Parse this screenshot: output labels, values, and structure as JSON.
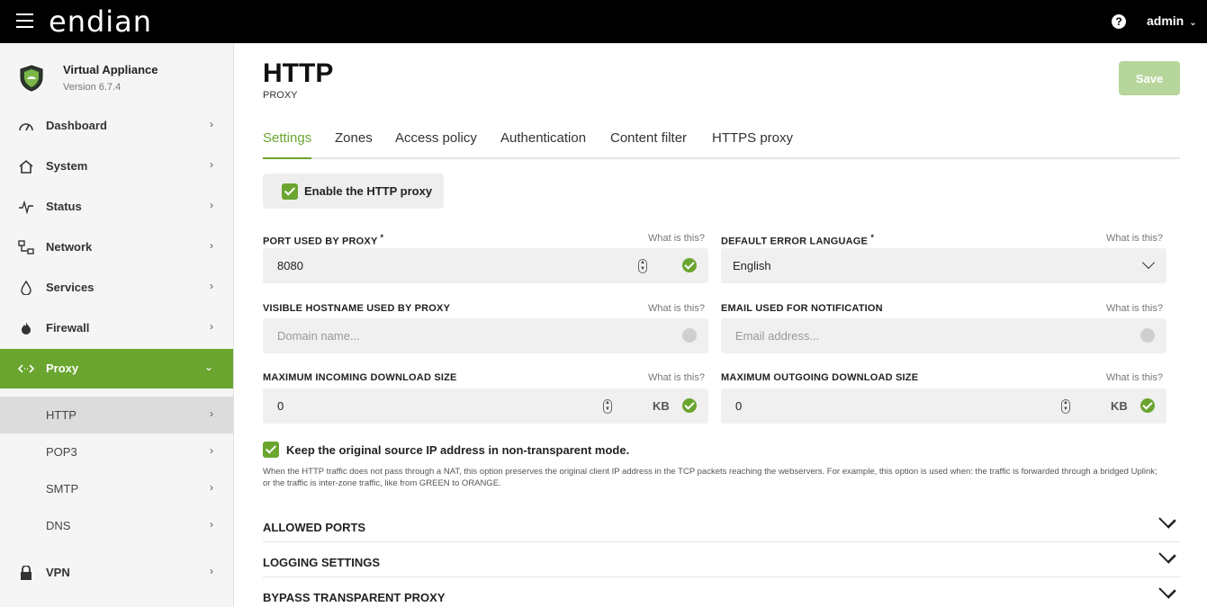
{
  "header": {
    "brand": "endian",
    "help_glyph": "?",
    "user": "admin"
  },
  "sidebar": {
    "appliance_name": "Virtual Appliance",
    "appliance_version": "Version 6.7.4",
    "items": [
      {
        "label": "Dashboard",
        "icon": "gauge-icon"
      },
      {
        "label": "System",
        "icon": "home-icon"
      },
      {
        "label": "Status",
        "icon": "pulse-icon"
      },
      {
        "label": "Network",
        "icon": "network-icon"
      },
      {
        "label": "Services",
        "icon": "drop-icon"
      },
      {
        "label": "Firewall",
        "icon": "flame-icon"
      },
      {
        "label": "Proxy",
        "icon": "code-arrows-icon"
      },
      {
        "label": "VPN",
        "icon": "lock-icon"
      }
    ],
    "proxy_sub": [
      "HTTP",
      "POP3",
      "SMTP",
      "DNS"
    ]
  },
  "page": {
    "title": "HTTP",
    "subtitle": "PROXY",
    "save_label": "Save",
    "tabs": [
      "Settings",
      "Zones",
      "Access policy",
      "Authentication",
      "Content filter",
      "HTTPS proxy"
    ]
  },
  "form": {
    "enable_label": "Enable the HTTP proxy",
    "what_is_this": "What is this?",
    "port_label": "PORT USED BY PROXY",
    "port_value": "8080",
    "error_lang_label": "DEFAULT ERROR LANGUAGE",
    "error_lang_value": "English",
    "hostname_label": "VISIBLE HOSTNAME USED BY PROXY",
    "hostname_placeholder": "Domain name...",
    "email_label": "EMAIL USED FOR NOTIFICATION",
    "email_placeholder": "Email address...",
    "max_in_label": "MAXIMUM INCOMING DOWNLOAD SIZE",
    "max_in_value": "0",
    "max_out_label": "MAXIMUM OUTGOING DOWNLOAD SIZE",
    "max_out_value": "0",
    "unit": "KB",
    "required_mark": "*",
    "keep_ip_label": "Keep the original source IP address in non-transparent mode.",
    "keep_ip_help": "When the HTTP traffic does not pass through a NAT, this option preserves the original client IP address in the TCP packets reaching the webservers. For example, this option is used when: the traffic is forwarded through a bridged Uplink; or the traffic is inter-zone traffic, like from GREEN to ORANGE."
  },
  "sections": [
    "ALLOWED PORTS",
    "LOGGING SETTINGS",
    "BYPASS TRANSPARENT PROXY"
  ],
  "colors": {
    "accent": "#6aa52f",
    "save_disabled": "#b7d69c"
  }
}
